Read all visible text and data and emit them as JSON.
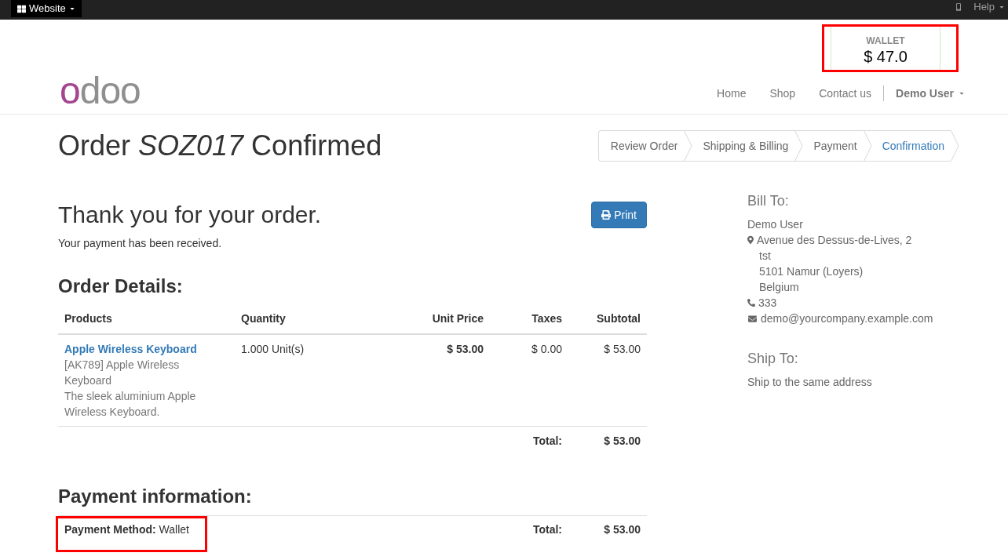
{
  "top_bar": {
    "website_menu": "Website",
    "help_menu": "Help"
  },
  "header": {
    "wallet": {
      "label": "WALLET",
      "amount": "$ 47.0",
      "highlighted": true
    },
    "logo": "odoo",
    "nav": [
      {
        "label": "Home"
      },
      {
        "label": "Shop"
      },
      {
        "label": "Contact us"
      }
    ],
    "user_menu": "Demo User"
  },
  "page_title": "Order *SOZ017* Confirmed",
  "checkout_steps": [
    {
      "label": "Review Order",
      "selected": false
    },
    {
      "label": "Shipping & Billing",
      "selected": false
    },
    {
      "label": "Payment",
      "selected": false
    },
    {
      "label": "Confirmation",
      "selected": true
    }
  ],
  "thank_you": {
    "heading": "Thank you for your order.",
    "message": "Your payment has been received.",
    "print_button": "Print"
  },
  "order_details": {
    "heading": "Order Details:",
    "columns": [
      "Products",
      "Quantity",
      "Unit Price",
      "Taxes",
      "Subtotal"
    ],
    "rows": [
      {
        "product": "Apple Wireless Keyboard",
        "description": [
          "[AK789] Apple Wireless Keyboard",
          "The sleek aluminium Apple Wireless Keyboard."
        ],
        "quantity": "1.000 Unit(s)",
        "unit_price": "$ 53.00",
        "taxes": "$ 0.00",
        "subtotal": "$ 53.00"
      }
    ],
    "total_label": "Total:",
    "total": "$ 53.00"
  },
  "payment_information": {
    "heading": "Payment information:",
    "method": "**Payment Method:** Wallet",
    "highlighted": true,
    "total_label": "Total:",
    "total": "$ 53.00"
  },
  "bill_to": {
    "heading": "Bill To:",
    "name": "Demo User",
    "address": [
      "Avenue des Dessus-de-Lives, 2",
      "tst",
      "5101 Namur (Loyers)",
      "Belgium"
    ],
    "phone": "333",
    "email": "demo@yourcompany.example.com"
  },
  "ship_to": {
    "heading": "Ship To:",
    "text": "Ship to the same address"
  }
}
